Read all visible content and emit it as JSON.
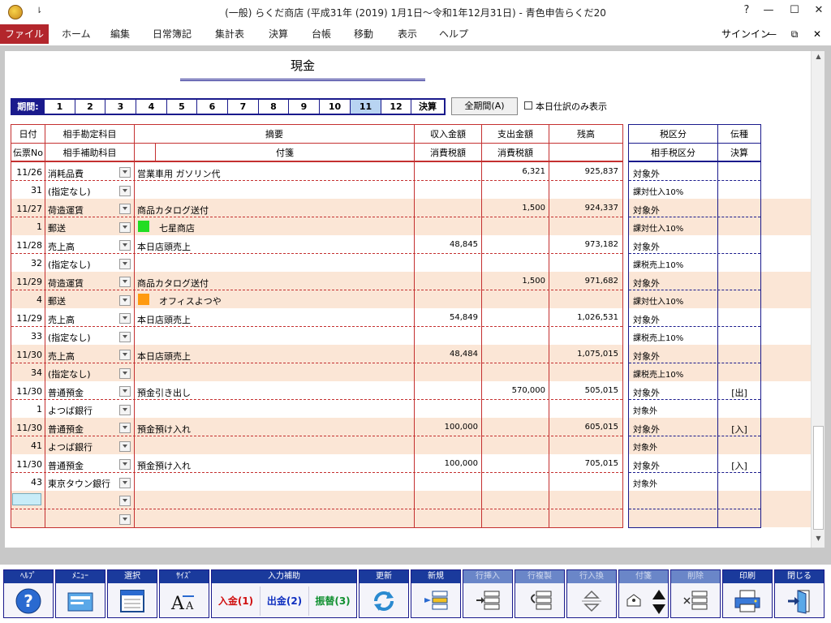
{
  "window": {
    "title": "(一般) らくだ商店 (平成31年 (2019) 1月1日～令和1年12月31日) - 青色申告らくだ20",
    "quick_access": "⇂",
    "help": "?",
    "minimize": "—",
    "maximize": "☐",
    "close": "✕"
  },
  "menu": {
    "file": "ファイル",
    "items": [
      "ホーム",
      "編集",
      "日常簿記",
      "集計表",
      "決算",
      "台帳",
      "移動",
      "表示",
      "ヘルプ"
    ],
    "signin": "サインイン",
    "ribbon_min": "—",
    "ribbon_restore": "⧉",
    "ribbon_close": "✕"
  },
  "page": {
    "title": "現金"
  },
  "period": {
    "label": "期間:",
    "months": [
      "1",
      "2",
      "3",
      "4",
      "5",
      "6",
      "7",
      "8",
      "9",
      "10",
      "11",
      "12"
    ],
    "selected": "11",
    "closing": "決算",
    "all_button": "全期間(A)",
    "today_only": "本日仕訳のみ表示"
  },
  "headers": {
    "date": "日付",
    "voucher": "伝票No",
    "account": "相手勘定科目",
    "subaccount": "相手補助科目",
    "summary": "摘要",
    "tag": "付箋",
    "income": "収入金額",
    "income_tax": "消費税額",
    "expense": "支出金額",
    "expense_tax": "消費税額",
    "balance": "残高",
    "tax_class": "税区分",
    "partner_tax": "相手税区分",
    "slip_type": "伝種",
    "settle": "決算"
  },
  "rows": [
    {
      "date": "11/26",
      "no": "31",
      "account": "消耗品費",
      "sub": "(指定なし)",
      "summary": "営業車用 ガソリン代",
      "tag": "",
      "tag_color": "",
      "income": "",
      "expense": "6,321",
      "balance": "925,837",
      "tax": "対象外",
      "ptax": "課対仕入10%",
      "slip": "",
      "band": "#ffffff"
    },
    {
      "date": "11/27",
      "no": "1",
      "account": "荷造運賃",
      "sub": "郵送",
      "summary": "商品カタログ送付",
      "tag": "七星商店",
      "tag_color": "#22dd22",
      "income": "",
      "expense": "1,500",
      "balance": "924,337",
      "tax": "対象外",
      "ptax": "課対仕入10%",
      "slip": "",
      "band": "#fbe6d6"
    },
    {
      "date": "11/28",
      "no": "32",
      "account": "売上高",
      "sub": "(指定なし)",
      "summary": "本日店頭売上",
      "tag": "",
      "tag_color": "",
      "income": "48,845",
      "expense": "",
      "balance": "973,182",
      "tax": "対象外",
      "ptax": "課税売上10%",
      "slip": "",
      "band": "#ffffff"
    },
    {
      "date": "11/29",
      "no": "4",
      "account": "荷造運賃",
      "sub": "郵送",
      "summary": "商品カタログ送付",
      "tag": "オフィスよつや",
      "tag_color": "#ff9a10",
      "income": "",
      "expense": "1,500",
      "balance": "971,682",
      "tax": "対象外",
      "ptax": "課対仕入10%",
      "slip": "",
      "band": "#fbe6d6"
    },
    {
      "date": "11/29",
      "no": "33",
      "account": "売上高",
      "sub": "(指定なし)",
      "summary": "本日店頭売上",
      "tag": "",
      "tag_color": "",
      "income": "54,849",
      "expense": "",
      "balance": "1,026,531",
      "tax": "対象外",
      "ptax": "課税売上10%",
      "slip": "",
      "band": "#ffffff"
    },
    {
      "date": "11/30",
      "no": "34",
      "account": "売上高",
      "sub": "(指定なし)",
      "summary": "本日店頭売上",
      "tag": "",
      "tag_color": "",
      "income": "48,484",
      "expense": "",
      "balance": "1,075,015",
      "tax": "対象外",
      "ptax": "課税売上10%",
      "slip": "",
      "band": "#fbe6d6"
    },
    {
      "date": "11/30",
      "no": "1",
      "account": "普通預金",
      "sub": "よつば銀行",
      "summary": "預金引き出し",
      "tag": "",
      "tag_color": "",
      "income": "",
      "expense": "570,000",
      "balance": "505,015",
      "tax": "対象外",
      "ptax": "対象外",
      "slip": "[出]",
      "band": "#ffffff"
    },
    {
      "date": "11/30",
      "no": "41",
      "account": "普通預金",
      "sub": "よつば銀行",
      "summary": "預金預け入れ",
      "tag": "",
      "tag_color": "",
      "income": "100,000",
      "expense": "",
      "balance": "605,015",
      "tax": "対象外",
      "ptax": "対象外",
      "slip": "[入]",
      "band": "#fbe6d6"
    },
    {
      "date": "11/30",
      "no": "43",
      "account": "普通預金",
      "sub": "東京タウン銀行",
      "summary": "預金預け入れ",
      "tag": "",
      "tag_color": "",
      "income": "100,000",
      "expense": "",
      "balance": "705,015",
      "tax": "対象外",
      "ptax": "対象外",
      "slip": "[入]",
      "band": "#ffffff"
    },
    {
      "date": "",
      "no": "",
      "account": "",
      "sub": "",
      "summary": "",
      "tag": "",
      "tag_color": "",
      "income": "",
      "expense": "",
      "balance": "",
      "tax": "",
      "ptax": "",
      "slip": "",
      "band": "#fbe6d6"
    }
  ],
  "toolbar": {
    "help": "ﾍﾙﾌﾟ",
    "menu": "ﾒﾆｭｰ",
    "select": "選択",
    "size": "ｻｲｽﾞ",
    "input_assist": "入力補助",
    "deposit": "入金(1)",
    "withdraw": "出金(2)",
    "transfer": "振替(3)",
    "update": "更新",
    "new": "新規",
    "insert_row": "行挿入",
    "copy_row": "行複製",
    "swap_row": "行入換",
    "tag": "付箋",
    "delete": "削除",
    "print": "印刷",
    "close": "閉じる"
  },
  "colors": {
    "accent": "#1a1a8c",
    "file_menu": "#b3262c",
    "grid_red": "#c43030",
    "band": "#fbe6d6"
  }
}
